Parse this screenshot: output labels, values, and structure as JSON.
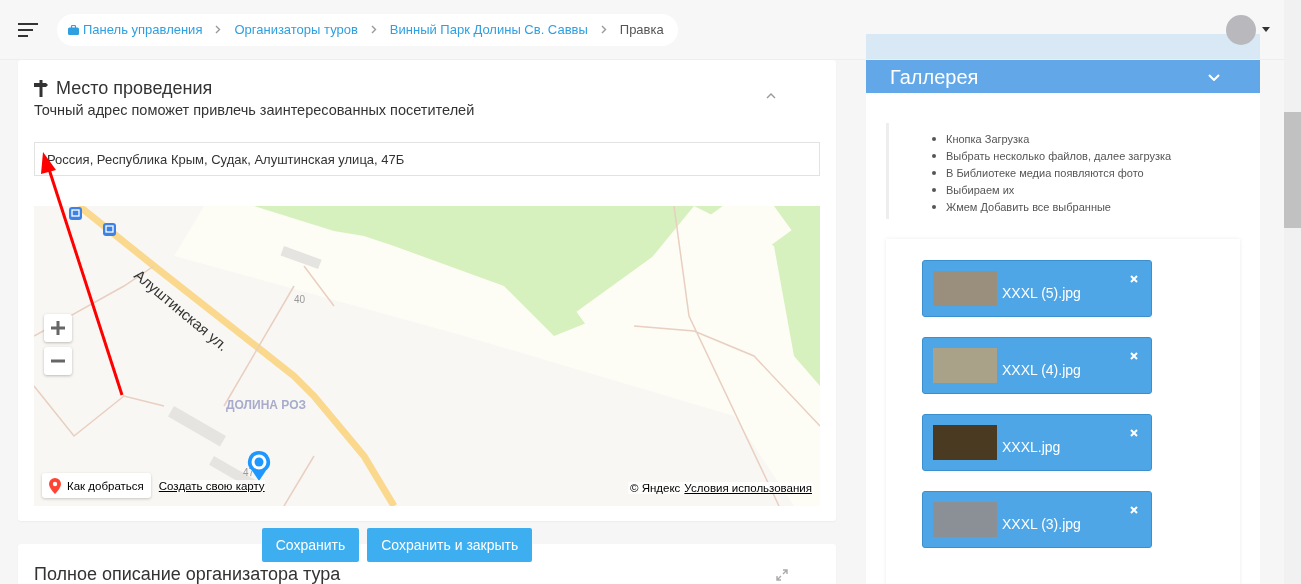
{
  "header": {
    "breadcrumbs": [
      {
        "label": "Панель управления",
        "link": true
      },
      {
        "label": "Организаторы туров",
        "link": true
      },
      {
        "label": "Винный Парк Долины Св. Саввы",
        "link": true
      },
      {
        "label": "Правка",
        "link": false
      }
    ]
  },
  "venue": {
    "title": "Место проведения",
    "subtitle": "Точный адрес поможет привлечь заинтересованных посетителей",
    "address": {
      "value": "Россия, Республика Крым, Судак, Алуштинская улица, 47Б"
    },
    "map": {
      "labels": [
        {
          "kind": "street",
          "text": "Алуштинская ул."
        },
        {
          "kind": "house",
          "text": "40"
        },
        {
          "kind": "area",
          "text": "ДОЛИНА РОЗ"
        },
        {
          "kind": "house",
          "text": "47"
        }
      ],
      "route_button": "Как добраться",
      "create_link": "Создать свою карту",
      "copyright": "© Яндекс",
      "terms_link": "Условия использования"
    }
  },
  "actions": [
    "Сохранить",
    "Сохранить и закрыть"
  ],
  "description_card": {
    "title": "Полное описание организатора тура"
  },
  "gallery": {
    "title": "Галлерея",
    "instructions": [
      "Кнопка Загрузка",
      "Выбрать несколько файлов, далее загрузка",
      "В Библиотеке медиа появляются фото",
      "Выбираем их",
      "Жмем Добавить все выбранные"
    ],
    "files": [
      {
        "name": "XXXL (5).jpg"
      },
      {
        "name": "XXXL (4).jpg"
      },
      {
        "name": "XXXL.jpg"
      },
      {
        "name": "XXXL (3).jpg"
      }
    ]
  }
}
